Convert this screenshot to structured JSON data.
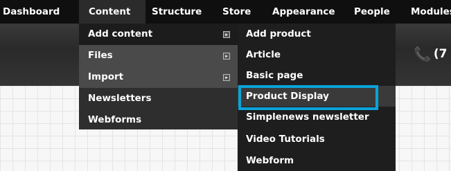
{
  "toolbar": {
    "items": [
      "Dashboard",
      "Content",
      "Structure",
      "Store",
      "Appearance",
      "People",
      "Modules"
    ]
  },
  "header": {
    "phone_number": "(7"
  },
  "content_menu": {
    "items": [
      "Add content",
      "Files",
      "Import",
      "Newsletters",
      "Webforms"
    ]
  },
  "add_content_menu": {
    "items": [
      "Add product",
      "Article",
      "Basic page",
      "Product Display",
      "Simplenews newsletter",
      "Video Tutorials",
      "Webform"
    ]
  },
  "colors": {
    "toolbar_bg": "#0f0f0f",
    "highlight_border": "#0aa4d9",
    "phone_icon": "#5cc24a"
  }
}
